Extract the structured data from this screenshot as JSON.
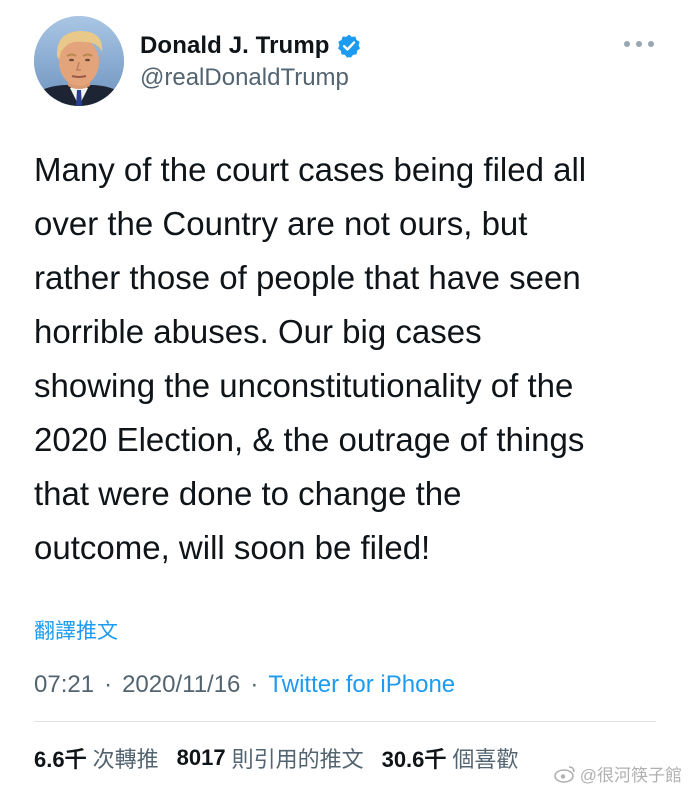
{
  "author": {
    "display_name": "Donald J. Trump",
    "handle": "@realDonaldTrump",
    "verified": true,
    "verified_color": "#1d9bf0"
  },
  "tweet": {
    "text": "Many of the court cases being filed all\nover the Country are not ours, but\nrather those of people that have seen\nhorrible abuses. Our big cases\nshowing the unconstitutionality of the\n2020 Election, & the outrage of things\nthat were done to change the\noutcome, will soon be filed!",
    "translate_label": "翻譯推文",
    "time": "07:21",
    "separator": "·",
    "date": "2020/11/16",
    "source": "Twitter for iPhone"
  },
  "stats": {
    "retweets_count": "6.6千",
    "retweets_label": "次轉推",
    "quotes_count": "8017",
    "quotes_label": "則引用的推文",
    "likes_count": "30.6千",
    "likes_label": "個喜歡"
  },
  "watermark": {
    "text": "@很河筷子館"
  },
  "icons": {
    "verified": "verified-badge-icon",
    "more": "more-options-icon",
    "watermark": "weibo-logo-icon"
  },
  "colors": {
    "link": "#1d9bf0",
    "secondary_text": "#536471",
    "primary_text": "#0f1419"
  }
}
